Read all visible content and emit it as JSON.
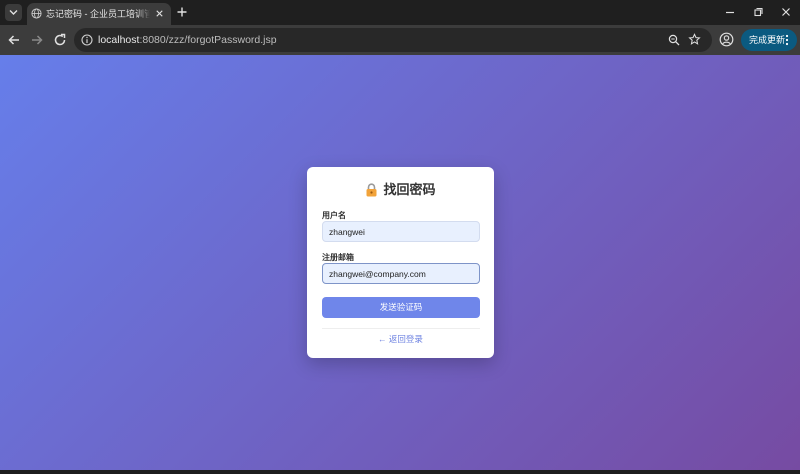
{
  "browser": {
    "tab_title": "忘记密码 - 企业员工培训管理系统",
    "url_host": "localhost",
    "url_rest": ":8080/zzz/forgotPassword.jsp",
    "update_button_label": "完成更新"
  },
  "card": {
    "title": "找回密码",
    "title_icon": "lock-icon",
    "username_label": "用户名",
    "username_value": "zhangwei",
    "email_label": "注册邮箱",
    "email_value": "zhangwei@company.com",
    "submit_label": "发送验证码",
    "back_link_label": "← 返回登录"
  },
  "colors": {
    "background_gradient_start": "#667eea",
    "background_gradient_end": "#764ba2",
    "button": "#6f86ea",
    "link": "#7185e2",
    "input_fill": "#e8f0fe"
  }
}
